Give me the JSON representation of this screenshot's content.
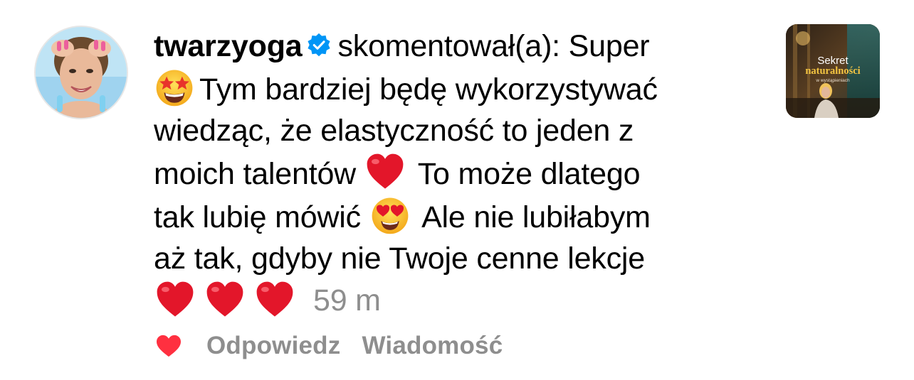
{
  "notification": {
    "username": "twarzyoga",
    "verified": true,
    "action_text": "skomentował(a): Super",
    "comment_lines": [
      "Tym bardziej będę wykorzystywać",
      "wiedząc, że elastyczność to jeden z",
      "moich talentów",
      "To może dlatego",
      "tak lubię mówić",
      "Ale nie lubiłabym",
      "aż tak, gdyby nie Twoje cenne lekcje"
    ],
    "time": "59 m",
    "emojis": [
      "star-struck",
      "red-heart",
      "heart-eyes",
      "red-heart",
      "red-heart",
      "red-heart"
    ]
  },
  "post_thumbnail": {
    "title_top": "Sekret",
    "title_main": "naturalności",
    "title_sub": "w wystąpieniach"
  },
  "actions": {
    "reply_label": "Odpowiedz",
    "message_label": "Wiadomość"
  },
  "colors": {
    "text": "#000000",
    "secondary_text": "#8e8e8e",
    "verified_blue": "#0095f6",
    "like_red": "#ff3040",
    "heart_red": "#e3162a"
  }
}
